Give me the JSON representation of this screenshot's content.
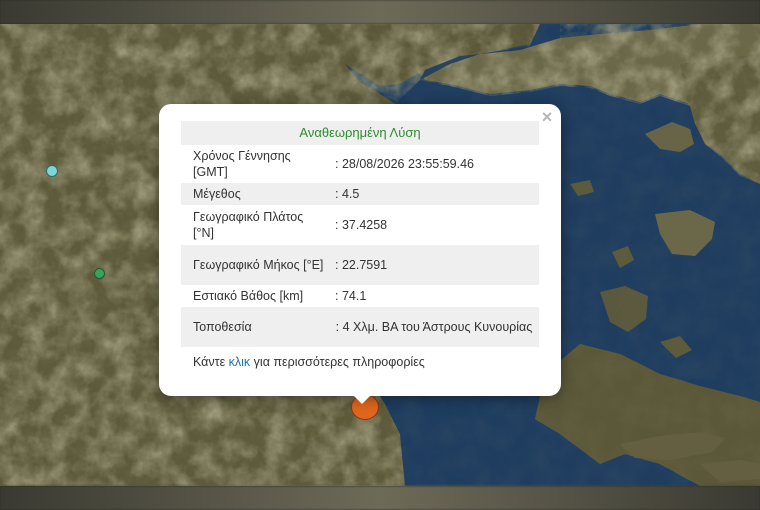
{
  "popup": {
    "header": "Αναθεωρημένη Λύση",
    "close_symbol": "×",
    "rows": [
      {
        "label": "Χρόνος Γέννησης [GMT]",
        "value": ": 28/08/2026 23:55:59.46"
      },
      {
        "label": "Μέγεθος",
        "value": ": 4.5"
      },
      {
        "label": "Γεωγραφικό Πλάτος [°N]",
        "value": ": 37.4258"
      },
      {
        "label": "Γεωγραφικό Μήκος [°E]",
        "value": ": 22.7591"
      },
      {
        "label": "Εστιακό Βάθος [km]",
        "value": ": 74.1"
      },
      {
        "label": "Τοποθεσία",
        "value": ": 4 Χλμ. ΒΑ του Άστρους Κυνουρίας"
      }
    ],
    "footer_before": "Κάντε ",
    "footer_link": "κλικ",
    "footer_after": " για περισσότερες πληροφορίες"
  },
  "markers": [
    {
      "name": "earthquake-marker-selected",
      "color": "#e0661e"
    },
    {
      "name": "earthquake-marker-cyan",
      "color": "#7fd6d6"
    },
    {
      "name": "earthquake-marker-green",
      "color": "#3aa35a"
    }
  ],
  "colors": {
    "land": "#5d5a3a",
    "sea": "#1c3a5a",
    "header_green": "#2e8b2e",
    "link_blue": "#1f6fb5"
  }
}
